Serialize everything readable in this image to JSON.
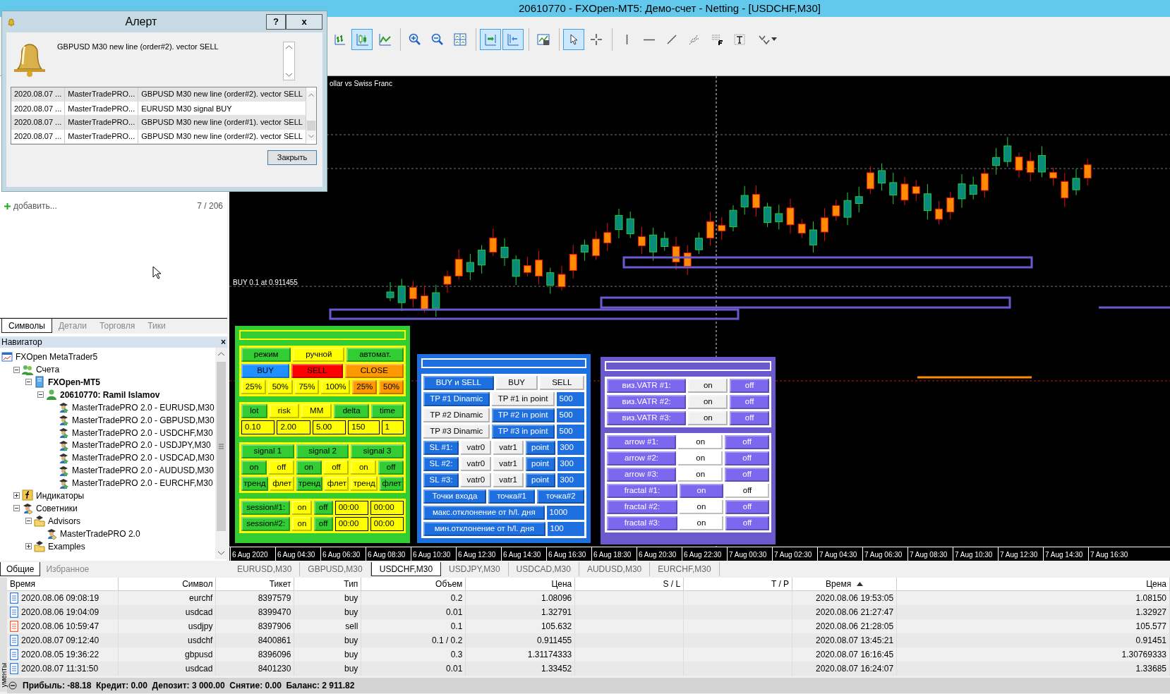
{
  "title_bar": {
    "title": "20610770 - FXOpen-MT5: Демо-счет - Netting - [USDCHF,M30]"
  },
  "toolbar": [
    {
      "kind": "bars",
      "selected": false
    },
    {
      "kind": "candles",
      "selected": true
    },
    {
      "kind": "line",
      "selected": false
    },
    {
      "kind": "zoom-in",
      "selected": false
    },
    {
      "kind": "zoom-out",
      "selected": false
    },
    {
      "kind": "tile",
      "selected": false
    },
    {
      "kind": "autoscroll",
      "selected": true
    },
    {
      "kind": "shift",
      "selected": true
    },
    {
      "kind": "template",
      "selected": false
    },
    {
      "kind": "cursor",
      "selected": true
    },
    {
      "kind": "crosshair",
      "selected": false
    },
    {
      "kind": "vline",
      "selected": false
    },
    {
      "kind": "hline",
      "selected": false
    },
    {
      "kind": "trendline",
      "selected": false
    },
    {
      "kind": "stairs",
      "selected": false
    },
    {
      "kind": "grid",
      "selected": false
    },
    {
      "kind": "text",
      "selected": false
    },
    {
      "kind": "arrows",
      "selected": false
    }
  ],
  "alert": {
    "title": "Алерт",
    "help": "?",
    "close": "x",
    "message": "GBPUSD M30 new line (order#2). vector SELL",
    "log": [
      {
        "time": "2020.08.07 ...",
        "source": "MasterTradePRO...",
        "text": "GBPUSD M30 new line (order#2). vector SELL"
      },
      {
        "time": "2020.08.07 ...",
        "source": "MasterTradePRO...",
        "text": "EURUSD M30 signal BUY"
      },
      {
        "time": "2020.08.07 ...",
        "source": "MasterTradePRO...",
        "text": "GBPUSD M30 new line (order#1). vector SELL"
      },
      {
        "time": "2020.08.07 ...",
        "source": "MasterTradePRO...",
        "text": "GBPUSD M30 new line (order#2). vector SELL"
      }
    ],
    "button": "Закрыть"
  },
  "market_watch": {
    "add_label": "добавить...",
    "count": "7 / 206"
  },
  "symbol_tabs": [
    {
      "label": "Символы",
      "selected": true
    },
    {
      "label": "Детали",
      "selected": false
    },
    {
      "label": "Торговля",
      "selected": false
    },
    {
      "label": "Тики",
      "selected": false
    }
  ],
  "navigator": {
    "title": "Навигатор",
    "close": "×",
    "tree": [
      {
        "label": "FXOpen MetaTrader5",
        "kind": "platform",
        "children": [
          {
            "label": "Счета",
            "kind": "accounts",
            "expanded": true,
            "children": [
              {
                "label": "FXOpen-MT5",
                "kind": "server",
                "expanded": true,
                "children": [
                  {
                    "label": "20610770: Ramil Islamov",
                    "kind": "account",
                    "expanded": true,
                    "children": [
                      {
                        "label": "MasterTradePRO 2.0 - EURUSD,M30",
                        "kind": "running-expert"
                      },
                      {
                        "label": "MasterTradePRO 2.0 - GBPUSD,M30",
                        "kind": "running-expert"
                      },
                      {
                        "label": "MasterTradePRO 2.0 - USDCHF,M30",
                        "kind": "running-expert"
                      },
                      {
                        "label": "MasterTradePRO 2.0 - USDJPY,M30",
                        "kind": "running-expert"
                      },
                      {
                        "label": "MasterTradePRO 2.0 - USDCAD,M30",
                        "kind": "running-expert"
                      },
                      {
                        "label": "MasterTradePRO 2.0 - AUDUSD,M30",
                        "kind": "running-expert"
                      },
                      {
                        "label": "MasterTradePRO 2.0 - EURCHF,M30",
                        "kind": "running-expert"
                      }
                    ]
                  }
                ]
              }
            ]
          },
          {
            "label": "Индикаторы",
            "kind": "indicators",
            "expanded": false
          },
          {
            "label": "Советники",
            "kind": "experts",
            "expanded": true,
            "children": [
              {
                "label": "Advisors",
                "kind": "folder",
                "expanded": true,
                "children": [
                  {
                    "label": "MasterTradePRO 2.0",
                    "kind": "expert"
                  }
                ]
              },
              {
                "label": "Examples",
                "kind": "folder",
                "expanded": false
              }
            ]
          }
        ]
      }
    ]
  },
  "navigator_tabs": [
    {
      "label": "Общие",
      "selected": true
    },
    {
      "label": "Избранное",
      "selected": false
    }
  ],
  "chart": {
    "caption": "ollar vs Swiss Franc",
    "trade_label": "BUY 0.1 at 0.911455",
    "time_axis": [
      "6 Aug 2020",
      "6 Aug 04:30",
      "6 Aug 06:30",
      "6 Aug 08:30",
      "6 Aug 10:30",
      "6 Aug 12:30",
      "6 Aug 14:30",
      "6 Aug 16:30",
      "6 Aug 18:30",
      "6 Aug 20:30",
      "6 Aug 22:30",
      "7 Aug 00:30",
      "7 Aug 02:30",
      "7 Aug 04:30",
      "7 Aug 06:30",
      "7 Aug 08:30",
      "7 Aug 10:30",
      "7 Aug 12:30",
      "7 Aug 14:30",
      "7 Aug 16:30"
    ],
    "panels": [
      {
        "color": "#32cd32",
        "sections": [
          {
            "rows": [
              [
                {
                  "kind": "button",
                  "label": "режим",
                  "color": "#32cd32"
                },
                {
                  "kind": "button",
                  "label": "ручной",
                  "color": "#ffff00"
                },
                {
                  "kind": "button",
                  "label": "автомат.",
                  "color": "#32cd32"
                }
              ],
              [
                {
                  "kind": "button",
                  "label": "BUY",
                  "color": "#1e90ff"
                },
                {
                  "kind": "button",
                  "label": "SELL",
                  "color": "#ff0000"
                },
                {
                  "kind": "button",
                  "label": "CLOSE",
                  "color": "#ff9900"
                }
              ],
              [
                {
                  "kind": "button",
                  "label": "25%",
                  "color": "#ffff00"
                },
                {
                  "kind": "button",
                  "label": "50%",
                  "color": "#ffff00"
                },
                {
                  "kind": "button",
                  "label": "75%",
                  "color": "#ffff00"
                },
                {
                  "kind": "button",
                  "label": "100%",
                  "color": "#ffff00"
                },
                {
                  "kind": "button",
                  "label": "25%",
                  "color": "#ff9900"
                },
                {
                  "kind": "button",
                  "label": "50%",
                  "color": "#ff9900"
                }
              ]
            ]
          },
          {
            "rows": [
              [
                {
                  "kind": "button",
                  "label": "lot",
                  "color": "#32cd32"
                },
                {
                  "kind": "button",
                  "label": "risk",
                  "color": "#ffff00"
                },
                {
                  "kind": "button",
                  "label": "MM",
                  "color": "#ffff00"
                },
                {
                  "kind": "button",
                  "label": "delta",
                  "color": "#32cd32"
                },
                {
                  "kind": "button",
                  "label": "time",
                  "color": "#32cd32"
                }
              ],
              [
                {
                  "kind": "field",
                  "label": "0.10",
                  "color": "#ffff00"
                },
                {
                  "kind": "field",
                  "label": "2.00",
                  "color": "#ffff00"
                },
                {
                  "kind": "field",
                  "label": "5.00",
                  "color": "#ffff00"
                },
                {
                  "kind": "field",
                  "label": "150",
                  "color": "#ffff00"
                },
                {
                  "kind": "field",
                  "label": "1",
                  "color": "#ffff00"
                }
              ]
            ]
          },
          {
            "rows": [
              [
                {
                  "kind": "button",
                  "label": "signal 1",
                  "color": "#32cd32"
                },
                {
                  "kind": "button",
                  "label": "signal 2",
                  "color": "#32cd32"
                },
                {
                  "kind": "button",
                  "label": "signal 3",
                  "color": "#32cd32"
                }
              ],
              [
                {
                  "kind": "button",
                  "label": "on",
                  "color": "#32cd32"
                },
                {
                  "kind": "button",
                  "label": "off",
                  "color": "#ffff00"
                },
                {
                  "kind": "button",
                  "label": "on",
                  "color": "#32cd32"
                },
                {
                  "kind": "button",
                  "label": "off",
                  "color": "#ffff00"
                },
                {
                  "kind": "button",
                  "label": "on",
                  "color": "#ffff00"
                },
                {
                  "kind": "button",
                  "label": "off",
                  "color": "#32cd32"
                }
              ],
              [
                {
                  "kind": "button",
                  "label": "тренд",
                  "color": "#32cd32"
                },
                {
                  "kind": "button",
                  "label": "флет",
                  "color": "#ffff00"
                },
                {
                  "kind": "button",
                  "label": "тренд",
                  "color": "#32cd32"
                },
                {
                  "kind": "button",
                  "label": "флет",
                  "color": "#ffff00"
                },
                {
                  "kind": "button",
                  "label": "тренд",
                  "color": "#ffff00"
                },
                {
                  "kind": "button",
                  "label": "флет",
                  "color": "#32cd32"
                }
              ]
            ]
          },
          {
            "rows": [
              [
                {
                  "kind": "button",
                  "label": "session#1:",
                  "color": "#32cd32"
                },
                {
                  "kind": "button",
                  "label": "on",
                  "color": "#ffff00"
                },
                {
                  "kind": "button",
                  "label": "off",
                  "color": "#32cd32"
                },
                {
                  "kind": "field",
                  "label": "00:00",
                  "color": "#ffff00"
                },
                {
                  "kind": "field",
                  "label": "00:00",
                  "color": "#ffff00"
                }
              ],
              [
                {
                  "kind": "button",
                  "label": "session#2:",
                  "color": "#32cd32"
                },
                {
                  "kind": "button",
                  "label": "on",
                  "color": "#ffff00"
                },
                {
                  "kind": "button",
                  "label": "off",
                  "color": "#32cd32"
                },
                {
                  "kind": "field",
                  "label": "00:00",
                  "color": "#ffff00"
                },
                {
                  "kind": "field",
                  "label": "00:00",
                  "color": "#ffff00"
                }
              ]
            ]
          }
        ]
      },
      {
        "color": "#1e6fe0",
        "sections": [
          {
            "rows": [
              [
                {
                  "kind": "button",
                  "label": "BUY и SELL",
                  "color": "#1e6fe0"
                },
                {
                  "kind": "button",
                  "label": "BUY",
                  "color": "#f0f0f0"
                },
                {
                  "kind": "button",
                  "label": "SELL",
                  "color": "#f0f0f0"
                }
              ],
              [
                {
                  "kind": "button",
                  "label": "TP #1 Dinamic",
                  "color": "#1e6fe0"
                },
                {
                  "kind": "button",
                  "label": "TP #1 in point",
                  "color": "#f0f0f0"
                },
                {
                  "kind": "field",
                  "label": "500",
                  "color": "#1e6fe0"
                }
              ],
              [
                {
                  "kind": "button",
                  "label": "TP #2 Dinamic",
                  "color": "#f0f0f0"
                },
                {
                  "kind": "button",
                  "label": "TP #2 in point",
                  "color": "#1e6fe0"
                },
                {
                  "kind": "field",
                  "label": "500",
                  "color": "#1e6fe0"
                }
              ],
              [
                {
                  "kind": "button",
                  "label": "TP #3 Dinamic",
                  "color": "#f0f0f0"
                },
                {
                  "kind": "button",
                  "label": "TP #3 in point",
                  "color": "#1e6fe0"
                },
                {
                  "kind": "field",
                  "label": "500",
                  "color": "#1e6fe0"
                }
              ],
              [
                {
                  "kind": "button",
                  "label": "SL #1:",
                  "color": "#1e6fe0"
                },
                {
                  "kind": "button",
                  "label": "vatr0",
                  "color": "#f0f0f0"
                },
                {
                  "kind": "button",
                  "label": "vatr1",
                  "color": "#f0f0f0"
                },
                {
                  "kind": "button",
                  "label": "point",
                  "color": "#1e6fe0"
                },
                {
                  "kind": "field",
                  "label": "300",
                  "color": "#1e6fe0"
                }
              ],
              [
                {
                  "kind": "button",
                  "label": "SL #2:",
                  "color": "#1e6fe0"
                },
                {
                  "kind": "button",
                  "label": "vatr0",
                  "color": "#f0f0f0"
                },
                {
                  "kind": "button",
                  "label": "vatr1",
                  "color": "#f0f0f0"
                },
                {
                  "kind": "button",
                  "label": "point",
                  "color": "#1e6fe0"
                },
                {
                  "kind": "field",
                  "label": "300",
                  "color": "#1e6fe0"
                }
              ],
              [
                {
                  "kind": "button",
                  "label": "SL #3:",
                  "color": "#1e6fe0"
                },
                {
                  "kind": "button",
                  "label": "vatr0",
                  "color": "#f0f0f0"
                },
                {
                  "kind": "button",
                  "label": "vatr1",
                  "color": "#f0f0f0"
                },
                {
                  "kind": "button",
                  "label": "point",
                  "color": "#1e6fe0"
                },
                {
                  "kind": "field",
                  "label": "300",
                  "color": "#1e6fe0"
                }
              ],
              [
                {
                  "kind": "button",
                  "label": "Точки входа",
                  "color": "#1e6fe0"
                },
                {
                  "kind": "button",
                  "label": "точка#1",
                  "color": "#1e6fe0"
                },
                {
                  "kind": "button",
                  "label": "точка#2",
                  "color": "#1e6fe0"
                }
              ],
              [
                {
                  "kind": "button",
                  "label": "макс.отклонение от h/l. дня",
                  "color": "#1e6fe0"
                },
                {
                  "kind": "field",
                  "label": "1000",
                  "color": "#1e6fe0"
                }
              ],
              [
                {
                  "kind": "button",
                  "label": "мин.отклонение от h/l. дня",
                  "color": "#1e6fe0"
                },
                {
                  "kind": "field",
                  "label": "100",
                  "color": "#1e6fe0"
                }
              ]
            ]
          }
        ]
      },
      {
        "color": "#6a5acd",
        "sections": [
          {
            "rows": [
              [
                {
                  "kind": "button",
                  "label": "виз.VATR #1:",
                  "color": "#7b68ee"
                },
                {
                  "kind": "button",
                  "label": "on",
                  "color": "#f0f0f0"
                },
                {
                  "kind": "button",
                  "label": "off",
                  "color": "#7b68ee"
                }
              ],
              [
                {
                  "kind": "button",
                  "label": "виз.VATR #2:",
                  "color": "#7b68ee"
                },
                {
                  "kind": "button",
                  "label": "on",
                  "color": "#f0f0f0"
                },
                {
                  "kind": "button",
                  "label": "off",
                  "color": "#7b68ee"
                }
              ],
              [
                {
                  "kind": "button",
                  "label": "виз.VATR #3:",
                  "color": "#7b68ee"
                },
                {
                  "kind": "button",
                  "label": "on",
                  "color": "#f0f0f0"
                },
                {
                  "kind": "button",
                  "label": "off",
                  "color": "#7b68ee"
                }
              ]
            ]
          },
          {
            "rows": [
              [
                {
                  "kind": "button",
                  "label": "arrow #1:",
                  "color": "#7b68ee"
                },
                {
                  "kind": "button",
                  "label": "on",
                  "color": "#ffffff"
                },
                {
                  "kind": "button",
                  "label": "off",
                  "color": "#7b68ee"
                }
              ],
              [
                {
                  "kind": "button",
                  "label": "arrow #2:",
                  "color": "#7b68ee"
                },
                {
                  "kind": "button",
                  "label": "on",
                  "color": "#ffffff"
                },
                {
                  "kind": "button",
                  "label": "off",
                  "color": "#7b68ee"
                }
              ],
              [
                {
                  "kind": "button",
                  "label": "arrow #3:",
                  "color": "#7b68ee"
                },
                {
                  "kind": "button",
                  "label": "on",
                  "color": "#ffffff"
                },
                {
                  "kind": "button",
                  "label": "off",
                  "color": "#7b68ee"
                }
              ],
              [
                {
                  "kind": "button",
                  "label": "fractal #1:",
                  "color": "#7b68ee"
                },
                {
                  "kind": "button",
                  "label": "on",
                  "color": "#7b68ee"
                },
                {
                  "kind": "button",
                  "label": "off",
                  "color": "#ffffff"
                }
              ],
              [
                {
                  "kind": "button",
                  "label": "fractal #2:",
                  "color": "#7b68ee"
                },
                {
                  "kind": "button",
                  "label": "on",
                  "color": "#ffffff"
                },
                {
                  "kind": "button",
                  "label": "off",
                  "color": "#7b68ee"
                }
              ],
              [
                {
                  "kind": "button",
                  "label": "fractal #3:",
                  "color": "#7b68ee"
                },
                {
                  "kind": "button",
                  "label": "on",
                  "color": "#ffffff"
                },
                {
                  "kind": "button",
                  "label": "off",
                  "color": "#7b68ee"
                }
              ]
            ]
          }
        ]
      }
    ]
  },
  "chart_tabs": [
    {
      "label": "EURUSD,M30",
      "selected": false
    },
    {
      "label": "GBPUSD,M30",
      "selected": false
    },
    {
      "label": "USDCHF,M30",
      "selected": true
    },
    {
      "label": "USDJPY,M30",
      "selected": false
    },
    {
      "label": "USDCAD,M30",
      "selected": false
    },
    {
      "label": "AUDUSD,M30",
      "selected": false
    },
    {
      "label": "EURCHF,M30",
      "selected": false
    }
  ],
  "trades": {
    "columns": [
      {
        "label": "Время",
        "sorted": false
      },
      {
        "label": "Символ",
        "sorted": false
      },
      {
        "label": "Тикет",
        "sorted": false
      },
      {
        "label": "Тип",
        "sorted": false
      },
      {
        "label": "Объем",
        "sorted": false
      },
      {
        "label": "Цена",
        "sorted": false
      },
      {
        "label": "S / L",
        "sorted": false
      },
      {
        "label": "T / P",
        "sorted": false
      },
      {
        "label": "Время",
        "sorted": true
      },
      {
        "label": "Цена",
        "sorted": false
      }
    ],
    "rows": [
      {
        "color": "#3c7fd8",
        "cells": [
          "2020.08.06 09:08:19",
          "eurchf",
          "8397579",
          "buy",
          "0.2",
          "1.08096",
          "",
          "",
          "2020.08.06 19:53:05",
          "1.08150"
        ]
      },
      {
        "color": "#3c7fd8",
        "cells": [
          "2020.08.06 19:04:09",
          "usdcad",
          "8399470",
          "buy",
          "0.01",
          "1.32791",
          "",
          "",
          "2020.08.06 21:27:47",
          "1.32927"
        ]
      },
      {
        "color": "#e8643c",
        "cells": [
          "2020.08.06 10:59:47",
          "usdjpy",
          "8397906",
          "sell",
          "0.1",
          "105.632",
          "",
          "",
          "2020.08.06 21:28:05",
          "105.577"
        ]
      },
      {
        "color": "#3c7fd8",
        "cells": [
          "2020.08.07 09:12:40",
          "usdchf",
          "8400861",
          "buy",
          "0.1 / 0.2",
          "0.911455",
          "",
          "",
          "2020.08.07 13:45:21",
          "0.91451"
        ]
      },
      {
        "color": "#3c7fd8",
        "cells": [
          "2020.08.05 19:36:22",
          "gbpusd",
          "8396096",
          "buy",
          "0.3",
          "1.31174333",
          "",
          "",
          "2020.08.07 16:16:45",
          "1.30769333"
        ]
      },
      {
        "color": "#3c7fd8",
        "cells": [
          "2020.08.07 11:31:50",
          "usdcad",
          "8401230",
          "buy",
          "0.01",
          "1.33452",
          "",
          "",
          "2020.08.07 16:24:07",
          "1.33685"
        ]
      }
    ]
  },
  "status_bar": {
    "side_label": "ументы",
    "summary": "Прибыль: -88.18  Кредит: 0.00  Депозит: 3 000.00  Снятие: 0.00  Баланс: 2 911.82"
  }
}
